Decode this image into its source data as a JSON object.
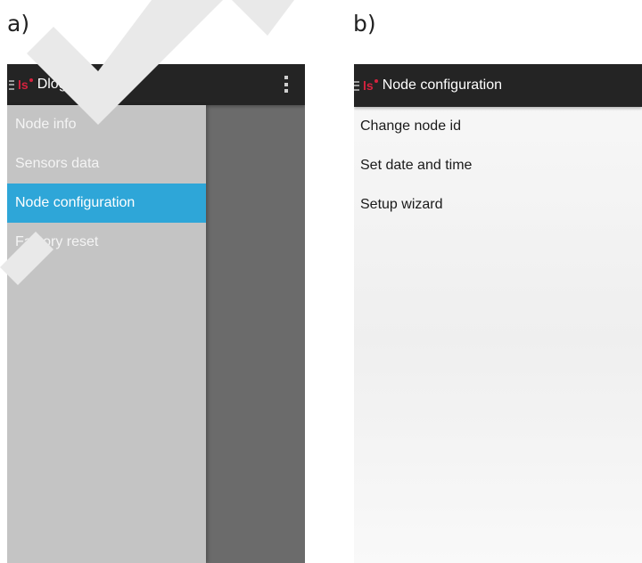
{
  "panels": {
    "a": {
      "letter": "a)",
      "app_title": "Dlog",
      "logo_text": "ls",
      "drawer_items": [
        "Node info",
        "Sensors data",
        "Node configuration",
        "Factory reset"
      ],
      "selected_index": 2
    },
    "b": {
      "letter": "b)",
      "screen_title": "Node configuration",
      "logo_text": "ls",
      "items": [
        "Change node id",
        "Set date and time",
        "Setup wizard"
      ]
    }
  },
  "icons": {
    "menu": "hamburger-icon",
    "logo": "brand-logo",
    "overflow": "overflow-menu-icon"
  },
  "colors": {
    "action_bar": "#242424",
    "logo_red": "#d6223e",
    "selected_item": "#2ea6d8",
    "drawer_bg": "#c4c4c4",
    "scrim": "#6b6b6b"
  }
}
